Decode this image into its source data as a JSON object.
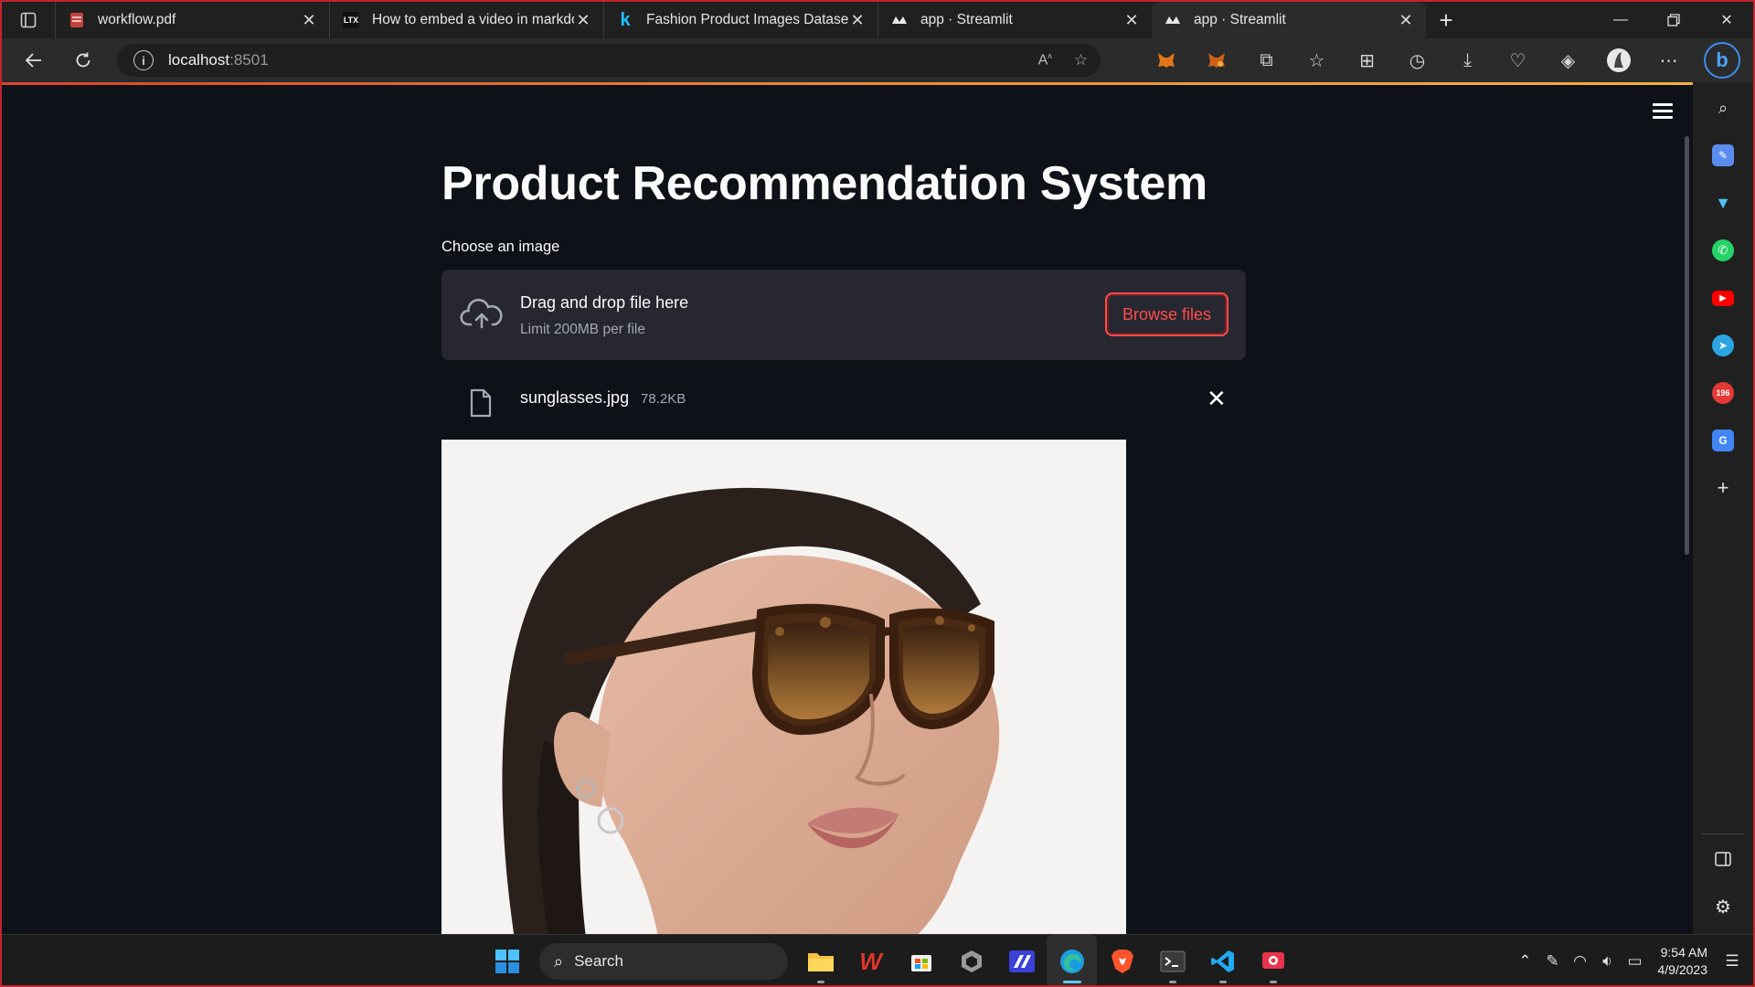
{
  "browser": {
    "tabs": [
      {
        "title": "workflow.pdf",
        "favicon": "pdf-icon",
        "active": false
      },
      {
        "title": "How to embed a video in markdo",
        "favicon": "ltx-icon",
        "active": false
      },
      {
        "title": "Fashion Product Images Dataset",
        "favicon": "kaggle-icon",
        "active": false
      },
      {
        "title": "app · Streamlit",
        "favicon": "streamlit-icon",
        "active": false
      },
      {
        "title": "app · Streamlit",
        "favicon": "streamlit-icon",
        "active": true
      }
    ],
    "favicon_text": {
      "ltx": "LTX",
      "kaggle": "k"
    },
    "address": {
      "host": "localhost",
      "port": ":8501"
    }
  },
  "app": {
    "title": "Product Recommendation System",
    "uploader": {
      "label": "Choose an image",
      "drop_text": "Drag and drop file here",
      "limit_text": "Limit 200MB per file",
      "browse_label": "Browse files"
    },
    "file": {
      "name": "sunglasses.jpg",
      "size": "78.2KB"
    },
    "accent_color": "#ff4b4b"
  },
  "sidebar": {
    "badge_count": "196"
  },
  "taskbar": {
    "search_placeholder": "Search",
    "time": "9:54 AM",
    "date": "4/9/2023"
  }
}
